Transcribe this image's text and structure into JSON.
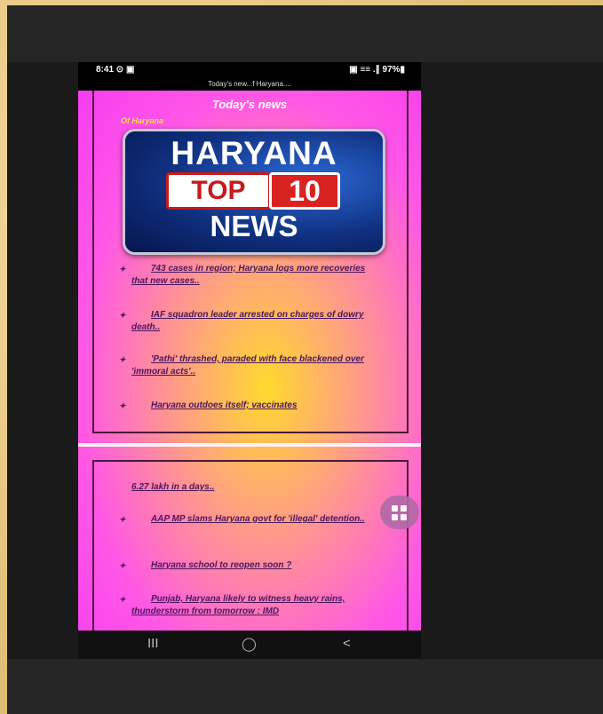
{
  "status_bar": {
    "time": "8:41 ⊙ ▣",
    "right": "▣ ≡≡ .∥ 97%▮"
  },
  "url_bar": "Today's new...f Haryana....",
  "page": {
    "title": "Today's  news",
    "subtitle": "Of Haryana",
    "logo": {
      "line1": "HARYANA",
      "top": "TOP",
      "ten": "10",
      "line3": "NEWS"
    }
  },
  "news_items": [
    {
      "text": "743 cases in region; Haryana logs more recoveries that new cases.."
    },
    {
      "text": "IAF squadron leader arrested on charges of dowry death.."
    },
    {
      "text": "'Pathi' thrashed, paraded with face blackened over 'immoral acts'.."
    },
    {
      "text": "Haryana outdoes itself; vaccinates"
    }
  ],
  "news_items_2": [
    {
      "text": "6.27 lakh in a days.."
    },
    {
      "text": "AAP MP slams Haryana govt for 'illegal' detention.."
    },
    {
      "text": "Haryana school to reopen soon ?"
    },
    {
      "text": "Punjab, Haryana likely to witness heavy rains, thunderstorm from tomorrow : IMD"
    }
  ],
  "bullet": "✦",
  "nav": {
    "recent": "III",
    "home": "◯",
    "back": "<"
  },
  "colors": {
    "accent_pink": "#f63cf0",
    "accent_yellow": "#ffd92e",
    "text": "#4a1660"
  }
}
